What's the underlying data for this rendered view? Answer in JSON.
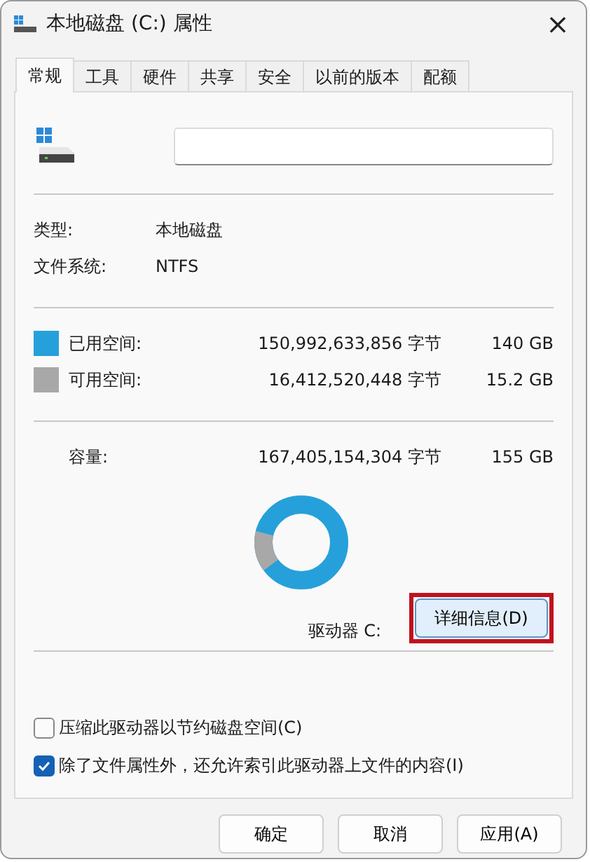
{
  "window": {
    "title": "本地磁盘 (C:) 属性",
    "close": "×"
  },
  "tabs": [
    {
      "label": "常规",
      "selected": true
    },
    {
      "label": "工具",
      "selected": false
    },
    {
      "label": "硬件",
      "selected": false
    },
    {
      "label": "共享",
      "selected": false
    },
    {
      "label": "安全",
      "selected": false
    },
    {
      "label": "以前的版本",
      "selected": false
    },
    {
      "label": "配额",
      "selected": false
    }
  ],
  "info": [
    {
      "label": "类型:",
      "value": "本地磁盘"
    },
    {
      "label": "文件系统:",
      "value": "NTFS"
    }
  ],
  "space": [
    {
      "label": "已用空间:",
      "bytes": "150,992,633,856 字节",
      "size": "140 GB",
      "color": "#26a0da"
    },
    {
      "label": "可用空间:",
      "bytes": "16,412,520,448 字节",
      "size": "15.2 GB",
      "color": "#a8a8a8"
    }
  ],
  "capacity": {
    "label": "容量:",
    "bytes": "167,405,154,304 字节",
    "size": "155 GB"
  },
  "drive_label": "驱动器 C:",
  "details_button": "详细信息(D)",
  "options": [
    {
      "label": "压缩此驱动器以节约磁盘空间(C)",
      "checked": false
    },
    {
      "label": "除了文件属性外，还允许索引此驱动器上文件的内容(I)",
      "checked": true
    }
  ],
  "buttons": [
    "确定",
    "取消",
    "应用(A)"
  ]
}
